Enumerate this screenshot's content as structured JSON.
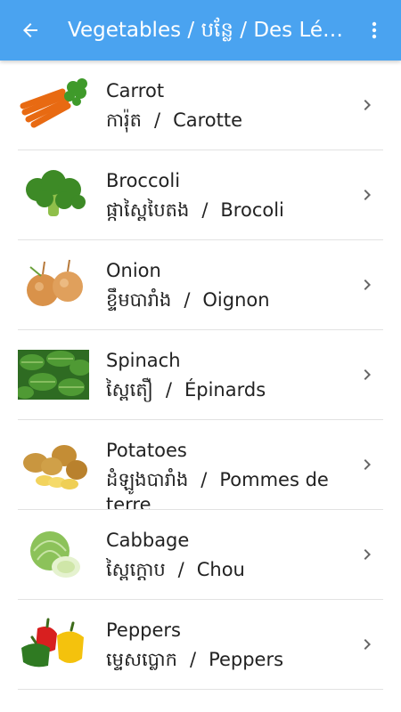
{
  "appbar": {
    "title": "Vegetables / បន្លែ / Des Légumes",
    "back_icon": "arrow-back-icon",
    "menu_icon": "more-vert-icon",
    "color": "#4aa3f0"
  },
  "items": [
    {
      "en": "Carrot",
      "km": "ការ៉ុត",
      "fr": "Carotte",
      "icon": "carrot-image"
    },
    {
      "en": "Broccoli",
      "km": "ផ្កាស្ពៃបៃតង",
      "fr": "Brocoli",
      "icon": "broccoli-image"
    },
    {
      "en": "Onion",
      "km": "ខ្ទឹមបារាំង",
      "fr": "Oignon",
      "icon": "onion-image"
    },
    {
      "en": "Spinach",
      "km": "ស្ពៃតឿ",
      "fr": "Épinards",
      "icon": "spinach-image"
    },
    {
      "en": "Potatoes",
      "km": "ដំឡូងបារាំង",
      "fr": "Pommes de terre",
      "icon": "potatoes-image"
    },
    {
      "en": "Cabbage",
      "km": "ស្ពៃក្តោប",
      "fr": "Chou",
      "icon": "cabbage-image"
    },
    {
      "en": "Peppers",
      "km": "ម្ទេសប្លោក",
      "fr": "Peppers",
      "icon": "peppers-image"
    }
  ],
  "separator": "/"
}
